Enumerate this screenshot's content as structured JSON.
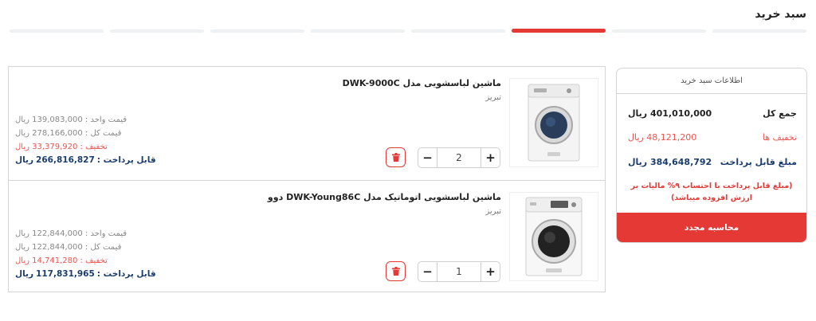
{
  "page": {
    "title": "سبد خرید"
  },
  "steps": {
    "count": 8,
    "active_index": 3,
    "accent_color": "#e53935"
  },
  "items": [
    {
      "name": "ماشین لباسشویی مدل DWK-9000C",
      "seller": "تبریز",
      "quantity": "2",
      "unit_price": "قیمت واحد : 139,083,000 ریال",
      "total_price": "قیمت کل : 278,166,000 ریال",
      "discount": "تخفیف : 33,379,920 ریال",
      "payable_label": "قابل پرداخت :",
      "payable_value": "266,816,827",
      "payable_unit": "ریال",
      "image_icon": "washing-machine-front-icon"
    },
    {
      "name": "ماشین لباسشویی اتوماتیک مدل DWK-Young86C دوو",
      "seller": "تبریز",
      "quantity": "1",
      "unit_price": "قیمت واحد : 122,844,000 ریال",
      "total_price": "قیمت کل : 122,844,000 ریال",
      "discount": "تخفیف : 14,741,280 ریال",
      "payable_label": "قابل پرداخت :",
      "payable_value": "117,831,965",
      "payable_unit": "ریال",
      "image_icon": "washing-machine-front-icon"
    }
  ],
  "qty_controls": {
    "plus": "+",
    "minus": "−"
  },
  "summary": {
    "header": "اطلاعات سبد خرید",
    "total_label": "جمع کل",
    "total_value": "401,010,000 ریال",
    "discount_label": "تخفیف ها",
    "discount_value": "48,121,200 ریال",
    "payable_label": "مبلغ قابل پرداخت",
    "payable_value": "384,648,792 ریال",
    "tax_note": "(مبلغ قابل پرداخت با احتساب ۹% مالیات بر ارزش افزوده میباشد)",
    "recalc_button": "محاسبه مجدد"
  },
  "colors": {
    "accent": "#e53935",
    "discount": "#ef5350",
    "payable": "#1a3d6d"
  }
}
